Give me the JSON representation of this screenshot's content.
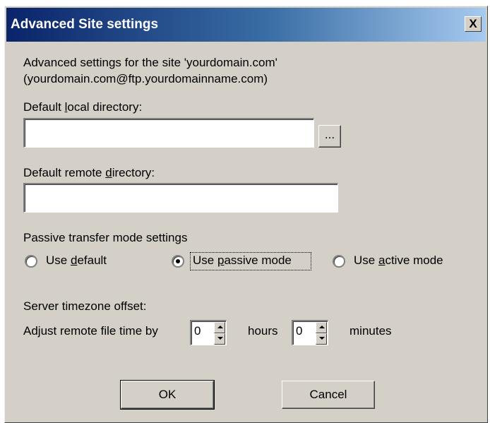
{
  "window": {
    "title": "Advanced Site settings",
    "close_glyph": "X"
  },
  "intro": {
    "line1": "Advanced settings for the site 'yourdomain.com'",
    "line2": "(yourdomain.com@ftp.yourdomainname.com)"
  },
  "local_dir": {
    "label_pre": "Default ",
    "label_key": "l",
    "label_post": "ocal directory:",
    "value": "",
    "browse_label": "..."
  },
  "remote_dir": {
    "label_pre": "Default remote ",
    "label_key": "d",
    "label_post": "irectory:",
    "value": ""
  },
  "passive": {
    "heading": "Passive transfer mode settings",
    "options": [
      {
        "pre": "Use ",
        "key": "d",
        "post": "efault",
        "selected": false
      },
      {
        "pre": "Use ",
        "key": "p",
        "post": "assive mode",
        "selected": true
      },
      {
        "pre": "Use ",
        "key": "a",
        "post": "ctive mode",
        "selected": false
      }
    ]
  },
  "timezone": {
    "heading": "Server timezone offset:",
    "adjust_label": "Adjust remote file time by",
    "hours_value": "0",
    "hours_label": "hours",
    "minutes_value": "0",
    "minutes_label": "minutes"
  },
  "buttons": {
    "ok": "OK",
    "cancel": "Cancel"
  }
}
